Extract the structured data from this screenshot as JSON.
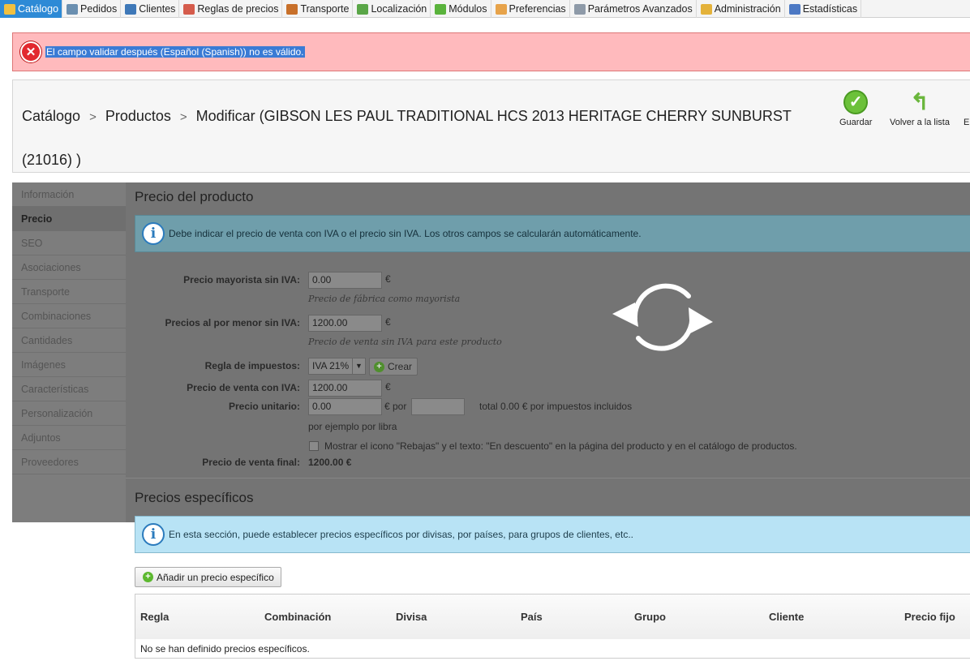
{
  "nav": {
    "tabs": [
      {
        "label": "Catálogo",
        "icon": "folder-icon",
        "color": "#f1c040",
        "active": true
      },
      {
        "label": "Pedidos",
        "icon": "cart-icon",
        "color": "#6a8fb0"
      },
      {
        "label": "Clientes",
        "icon": "user-icon",
        "color": "#3e78b8"
      },
      {
        "label": "Reglas de precios",
        "icon": "price-rules-icon",
        "color": "#d55c4c"
      },
      {
        "label": "Transporte",
        "icon": "truck-icon",
        "color": "#c8702a"
      },
      {
        "label": "Localización",
        "icon": "globe-icon",
        "color": "#5aa648"
      },
      {
        "label": "Módulos",
        "icon": "puzzle-icon",
        "color": "#5ab33c"
      },
      {
        "label": "Preferencias",
        "icon": "preferences-icon",
        "color": "#e7a34a"
      },
      {
        "label": "Parámetros Avanzados",
        "icon": "wrench-icon",
        "color": "#8e9aa8"
      },
      {
        "label": "Administración",
        "icon": "key-icon",
        "color": "#e4b23a"
      },
      {
        "label": "Estadísticas",
        "icon": "bar-chart-icon",
        "color": "#4d79c4"
      }
    ]
  },
  "error": {
    "message": "El campo validar después (Español (Spanish)) no es válido."
  },
  "header": {
    "crumb1": "Catálogo",
    "crumb2": "Productos",
    "crumb3": "Modificar (GIBSON LES PAUL TRADITIONAL HCS 2013 HERITAGE CHERRY SUNBURST (21016) )",
    "save_label": "Guardar",
    "back_label": "Volver a la lista",
    "cut_label": "El"
  },
  "sidebar": {
    "items": [
      "Información",
      "Precio",
      "SEO",
      "Asociaciones",
      "Transporte",
      "Combinaciones",
      "Cantidades",
      "Imágenes",
      "Características",
      "Personalización",
      "Adjuntos",
      "Proveedores"
    ],
    "active": "Precio"
  },
  "price": {
    "title": "Precio del producto",
    "info": "Debe indicar el precio de venta con IVA o el precio sin IVA. Los otros campos se calcularán automáticamente.",
    "wholesale_label": "Precio mayorista sin IVA:",
    "wholesale_value": "0.00",
    "wholesale_hint": "Precio de fábrica como mayorista",
    "retail_label": "Precios al por menor sin IVA:",
    "retail_value": "1200.00",
    "retail_hint": "Precio de venta sin IVA para este producto",
    "tax_label": "Regla de impuestos:",
    "tax_value": "IVA 21%",
    "create_label": "Crear",
    "with_tax_label": "Precio de venta con IVA:",
    "with_tax_value": "1200.00",
    "unit_label": "Precio unitario:",
    "unit_value": "0.00",
    "unit_per": "€ por",
    "unit_total": "total 0.00 € por impuestos incluidos",
    "unit_hint": "por ejemplo por libra",
    "on_sale_text": "Mostrar el icono \"Rebajas\" y el texto: \"En descuento\" en la página del producto y en el catálogo de productos.",
    "final_label": "Precio de venta final:",
    "final_value": "1200.00 €",
    "currency": "€"
  },
  "specific": {
    "title": "Precios específicos",
    "info": "En esta sección, puede establecer precios específicos por divisas, por países, para grupos de clientes, etc..",
    "add_label": "Añadir un precio específico",
    "columns": [
      "Regla",
      "Combinación",
      "Divisa",
      "País",
      "Grupo",
      "Cliente",
      "Precio fijo"
    ],
    "empty": "No se han definido precios específicos."
  }
}
